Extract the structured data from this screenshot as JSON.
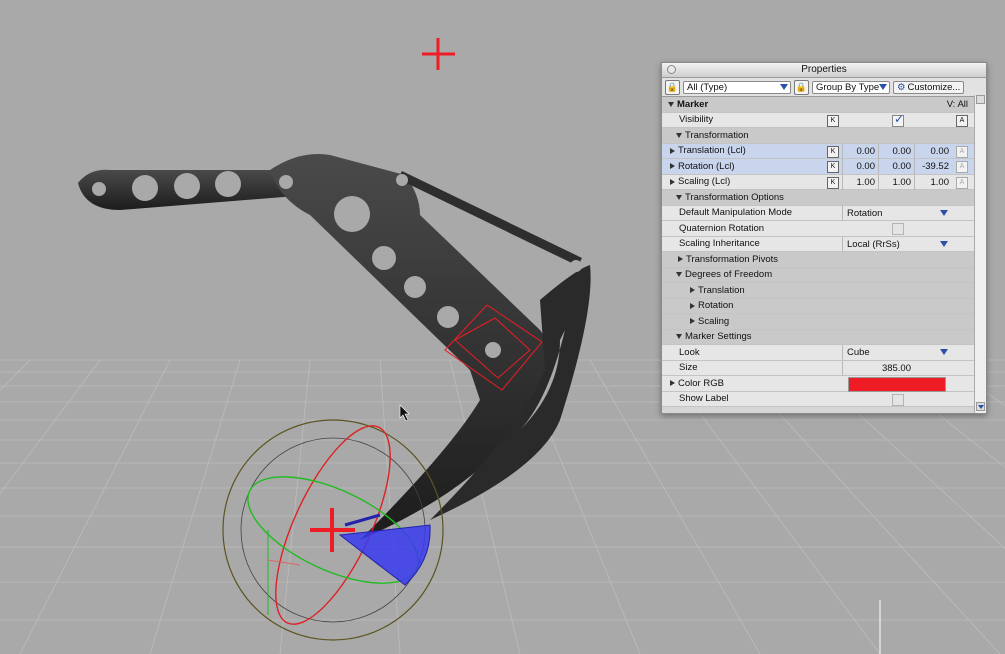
{
  "panel": {
    "title": "Properties",
    "filter_select": "All (Type)",
    "group_select": "Group By Type",
    "customize_label": "Customize..."
  },
  "rows": {
    "marker": {
      "label": "Marker",
      "right": "V: All"
    },
    "visibility": {
      "label": "Visibility",
      "k": "K",
      "a": "A"
    },
    "transformation": {
      "label": "Transformation"
    },
    "translation": {
      "label": "Translation (Lcl)",
      "k": "K",
      "x": "0.00",
      "y": "0.00",
      "z": "0.00",
      "a": "A"
    },
    "rotation": {
      "label": "Rotation (Lcl)",
      "k": "K",
      "x": "0.00",
      "y": "0.00",
      "z": "-39.52",
      "a": "A"
    },
    "scaling": {
      "label": "Scaling (Lcl)",
      "k": "K",
      "x": "1.00",
      "y": "1.00",
      "z": "1.00",
      "a": "A"
    },
    "transformation_options": {
      "label": "Transformation Options"
    },
    "default_manip": {
      "label": "Default Manipulation Mode",
      "value": "Rotation"
    },
    "quaternion": {
      "label": "Quaternion Rotation"
    },
    "scaling_inherit": {
      "label": "Scaling Inheritance",
      "value": "Local (RrSs)"
    },
    "pivots": {
      "label": "Transformation Pivots"
    },
    "dof": {
      "label": "Degrees of Freedom"
    },
    "dof_translation": {
      "label": "Translation"
    },
    "dof_rotation": {
      "label": "Rotation"
    },
    "dof_scaling": {
      "label": "Scaling"
    },
    "marker_settings": {
      "label": "Marker Settings"
    },
    "look": {
      "label": "Look",
      "value": "Cube"
    },
    "size": {
      "label": "Size",
      "value": "385.00"
    },
    "color_rgb": {
      "label": "Color RGB",
      "color": "#ee1c24"
    },
    "show_label": {
      "label": "Show Label"
    }
  },
  "colors": {
    "viewport_bg": "#a9a9a9",
    "marker_red": "#ee1c24",
    "highlight_row": "#c9d5ec",
    "accent_blue": "#2b50a8"
  },
  "icons": {
    "lock": "lock-icon",
    "customize": "gear-icon"
  }
}
